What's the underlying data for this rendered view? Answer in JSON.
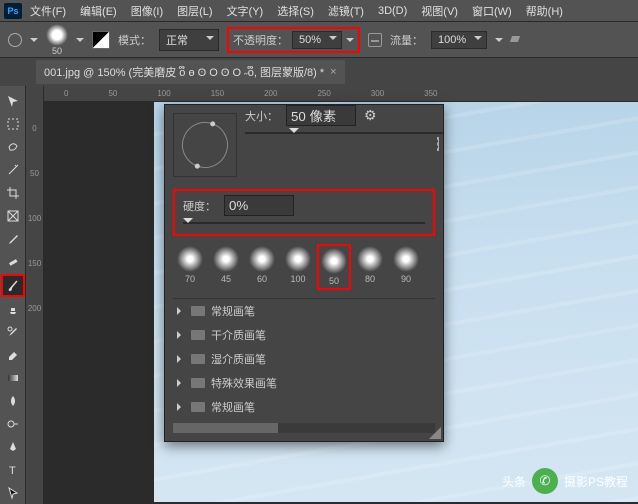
{
  "menubar": {
    "items": [
      "文件(F)",
      "编辑(E)",
      "图像(I)",
      "图层(L)",
      "文字(Y)",
      "选择(S)",
      "滤镜(T)",
      "3D(D)",
      "视图(V)",
      "窗口(W)",
      "帮助(H)"
    ]
  },
  "optionsbar": {
    "brush_size_preview": "50",
    "mode_label": "模式：",
    "mode_value": "正常",
    "opacity_label": "不透明度：",
    "opacity_value": "50%",
    "flow_label": "流量：",
    "flow_value": "100%"
  },
  "document_tab": {
    "title": "001.jpg @ 150% (完美磨皮 oຶ  ө  ʘ  O  ʘ  O ˶oຶ, 图层蒙版/8) *"
  },
  "ruler_h": [
    "0",
    "50",
    "100",
    "150",
    "200",
    "250",
    "300",
    "350"
  ],
  "ruler_v": [
    "0",
    "50",
    "100",
    "150",
    "200"
  ],
  "brush_panel": {
    "size_label": "大小：",
    "size_value": "50 像素",
    "hardness_label": "硬度：",
    "hardness_value": "0%",
    "size_slider_pos": 0.22,
    "hardness_slider_pos": 0.0,
    "presets": [
      {
        "size": "70"
      },
      {
        "size": "45"
      },
      {
        "size": "60"
      },
      {
        "size": "100"
      },
      {
        "size": "50",
        "highlight": true
      },
      {
        "size": "80"
      },
      {
        "size": "90"
      }
    ],
    "folders": [
      "常规画笔",
      "干介质画笔",
      "湿介质画笔",
      "特殊效果画笔",
      "常规画笔"
    ]
  },
  "watermark": {
    "prefix": "头条",
    "text": "摄影PS教程"
  }
}
